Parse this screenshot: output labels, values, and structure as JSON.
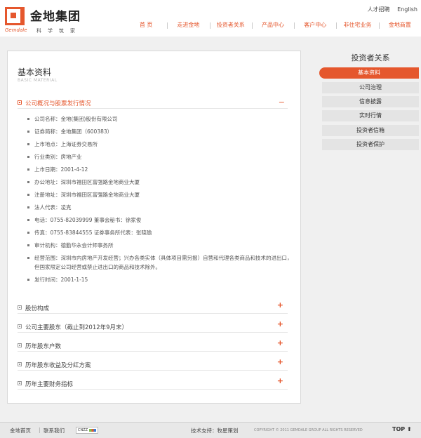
{
  "brand": {
    "name_cn": "金地集团",
    "name_en": "Gemdale",
    "slogan": "科学筑家"
  },
  "top_links": [
    "人才招聘",
    "English"
  ],
  "nav": [
    "首 页",
    "走进金地",
    "投资者关系",
    "产品中心",
    "客户中心",
    "非住宅业务",
    "金地商置"
  ],
  "main": {
    "title": "基本资料",
    "subtitle": "BASIC MATERIAL",
    "open_section": {
      "label": "公司概况与股票发行情况",
      "toggle": "−",
      "items": [
        "公司名称：金地(集团)股份有限公司",
        "证券简称：金地集团（600383）",
        "上市地点：上海证券交易所",
        "行业类别：房地产业",
        "上市日期：2001-4-12",
        "办公地址：深圳市福田区富强路金地商业大厦",
        "注册地址：深圳市福田区富强路金地商业大厦",
        "法人代表：凌克",
        "电话：0755-82039999 董事会秘书：徐家俊",
        "传真：0755-83844555 证券事务所代表：张晓瑜",
        "审计机构：德勤华永会计师事务所",
        "经营范围：深圳市内房地产开发经营；兴办各类实体（具体项目需另报）自营和代理各类商品和技术的进出口，但国家限定公司经营或禁止进出口的商品和技术除外。",
        "发行时间：2001-1-15"
      ]
    },
    "closed_sections": [
      {
        "label": "股份构成",
        "toggle": "+"
      },
      {
        "label": "公司主要股东（截止到2012年9月末）",
        "toggle": "+"
      },
      {
        "label": "历年股东户数",
        "toggle": "+"
      },
      {
        "label": "历年股东收益及分红方案",
        "toggle": "+"
      },
      {
        "label": "历年主要财务指标",
        "toggle": "+"
      }
    ]
  },
  "sidebar": {
    "title": "投资者关系",
    "items": [
      {
        "label": "基本资料",
        "active": true
      },
      {
        "label": "公司治理",
        "active": false
      },
      {
        "label": "信息披露",
        "active": false
      },
      {
        "label": "实时行情",
        "active": false
      },
      {
        "label": "投资者信箱",
        "active": false
      },
      {
        "label": "投资者保护",
        "active": false
      }
    ]
  },
  "footer": {
    "home": "金地首页",
    "separator": "|",
    "contact": "联系我们",
    "cnzz": "CNZZ",
    "support": "技术支持：牧星策划",
    "copyright": "COPYRIGHT © 2011  GEMDALE GROUP ALL RIGHTS RESERVED",
    "top": "TOP ⬆"
  },
  "colors": {
    "accent": "#e5572d",
    "sidebar_inactive": "#e4e4e4"
  }
}
